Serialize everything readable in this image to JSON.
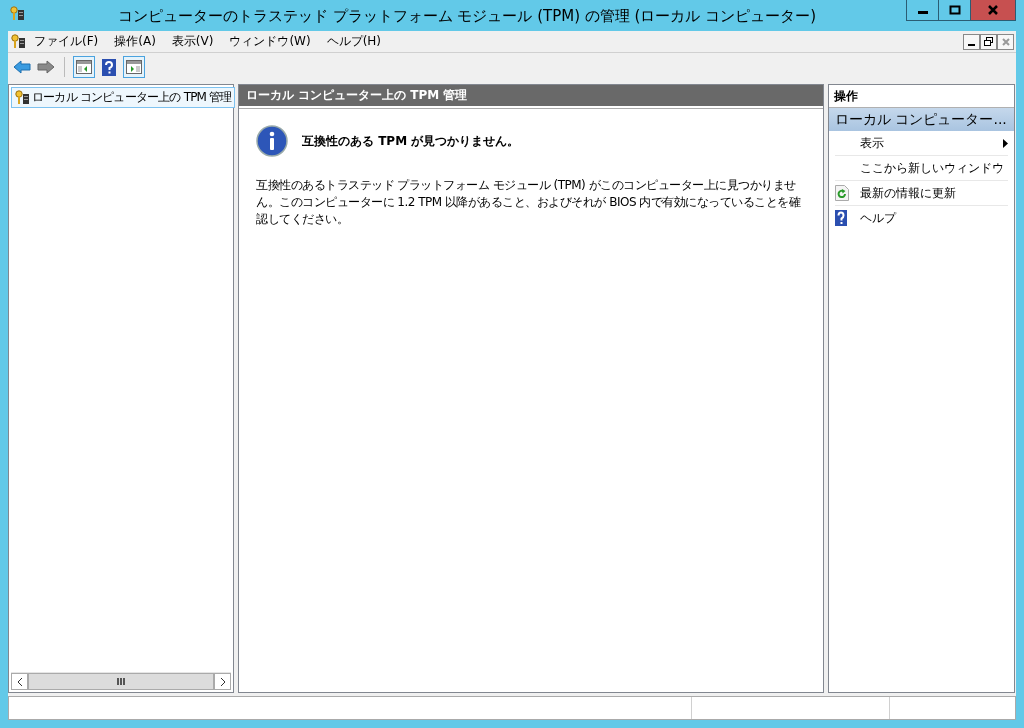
{
  "window": {
    "title": "コンピューターのトラステッド プラットフォーム モジュール (TPM) の管理 (ローカル コンピューター)"
  },
  "menu": [
    "ファイル(F)",
    "操作(A)",
    "表示(V)",
    "ウィンドウ(W)",
    "ヘルプ(H)"
  ],
  "tree": {
    "items": [
      {
        "label": "ローカル コンピューター上の TPM 管理",
        "selected": true
      }
    ]
  },
  "content": {
    "header": "ローカル コンピューター上の TPM 管理",
    "message_title": "互換性のある TPM が見つかりません。",
    "message_body": "互換性のあるトラステッド プラットフォーム モジュール (TPM) がこのコンピューター上に見つかりません。このコンピューターに 1.2 TPM 以降があること、およびそれが BIOS 内で有効になっていることを確認してください。"
  },
  "actions": {
    "header": "操作",
    "group": {
      "title": "ローカル コンピューター...",
      "expanded": true
    },
    "items": [
      {
        "kind": "submenu",
        "label": "表示"
      },
      {
        "kind": "plain",
        "label": "ここから新しいウィンドウ"
      },
      {
        "kind": "refresh",
        "label": "最新の情報に更新"
      },
      {
        "kind": "help",
        "label": "ヘルプ"
      }
    ]
  }
}
